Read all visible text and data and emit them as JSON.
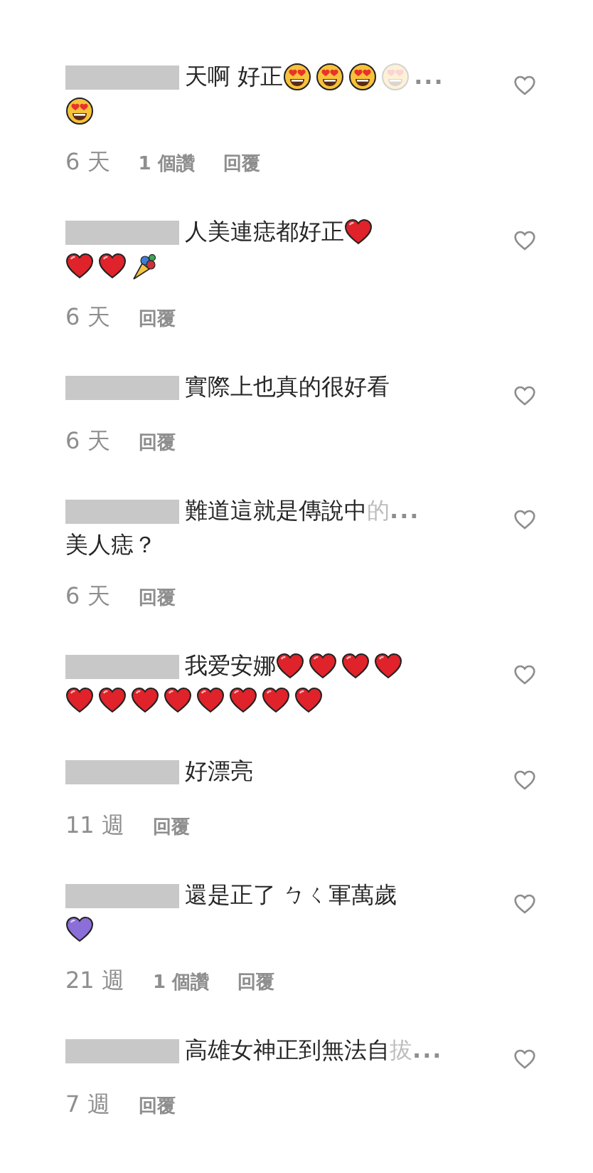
{
  "comments": [
    {
      "lines": [
        [
          {
            "kind": "text",
            "text": "天啊 好正 "
          },
          {
            "kind": "heart-eyes"
          },
          {
            "kind": "heart-eyes"
          },
          {
            "kind": "heart-eyes"
          },
          {
            "kind": "heart-eyes",
            "faded": true
          },
          {
            "kind": "ellipsis",
            "text": "..."
          }
        ],
        [
          {
            "kind": "heart-eyes"
          }
        ]
      ],
      "time": "6 天",
      "likes": "1 個讚",
      "reply": "回覆"
    },
    {
      "lines": [
        [
          {
            "kind": "text",
            "text": "人美連痣都好正"
          },
          {
            "kind": "red-heart"
          }
        ],
        [
          {
            "kind": "red-heart"
          },
          {
            "kind": "red-heart"
          },
          {
            "kind": "bouquet"
          }
        ]
      ],
      "time": "6 天",
      "reply": "回覆"
    },
    {
      "lines": [
        [
          {
            "kind": "text",
            "text": "實際上也真的很好看"
          }
        ]
      ],
      "time": "6 天",
      "reply": "回覆"
    },
    {
      "lines": [
        [
          {
            "kind": "text",
            "text": "難道這就是傳說中"
          },
          {
            "kind": "text",
            "text": "的",
            "faded": true
          },
          {
            "kind": "ellipsis",
            "text": "..."
          }
        ],
        [
          {
            "kind": "text",
            "text": "美人痣？"
          }
        ]
      ],
      "time": "6 天",
      "reply": "回覆"
    },
    {
      "lines": [
        [
          {
            "kind": "text",
            "text": "我爱安娜"
          },
          {
            "kind": "red-heart"
          },
          {
            "kind": "red-heart"
          },
          {
            "kind": "red-heart"
          },
          {
            "kind": "red-heart"
          }
        ],
        [
          {
            "kind": "red-heart"
          },
          {
            "kind": "red-heart"
          },
          {
            "kind": "red-heart"
          },
          {
            "kind": "red-heart"
          },
          {
            "kind": "red-heart"
          },
          {
            "kind": "red-heart"
          },
          {
            "kind": "red-heart"
          },
          {
            "kind": "red-heart"
          }
        ]
      ]
    },
    {
      "lines": [
        [
          {
            "kind": "text",
            "text": "好漂亮"
          }
        ]
      ],
      "time": "11 週",
      "reply": "回覆"
    },
    {
      "lines": [
        [
          {
            "kind": "text",
            "text": "還是正了 ㄅㄑ軍萬歲"
          }
        ],
        [
          {
            "kind": "purple-heart"
          }
        ]
      ],
      "time": "21 週",
      "likes": "1 個讚",
      "reply": "回覆"
    },
    {
      "lines": [
        [
          {
            "kind": "text",
            "text": " 高雄女神正到無法自"
          },
          {
            "kind": "text",
            "text": "拔",
            "faded": true
          },
          {
            "kind": "ellipsis",
            "text": "..."
          }
        ]
      ],
      "time": "7 週",
      "reply": "回覆"
    }
  ]
}
